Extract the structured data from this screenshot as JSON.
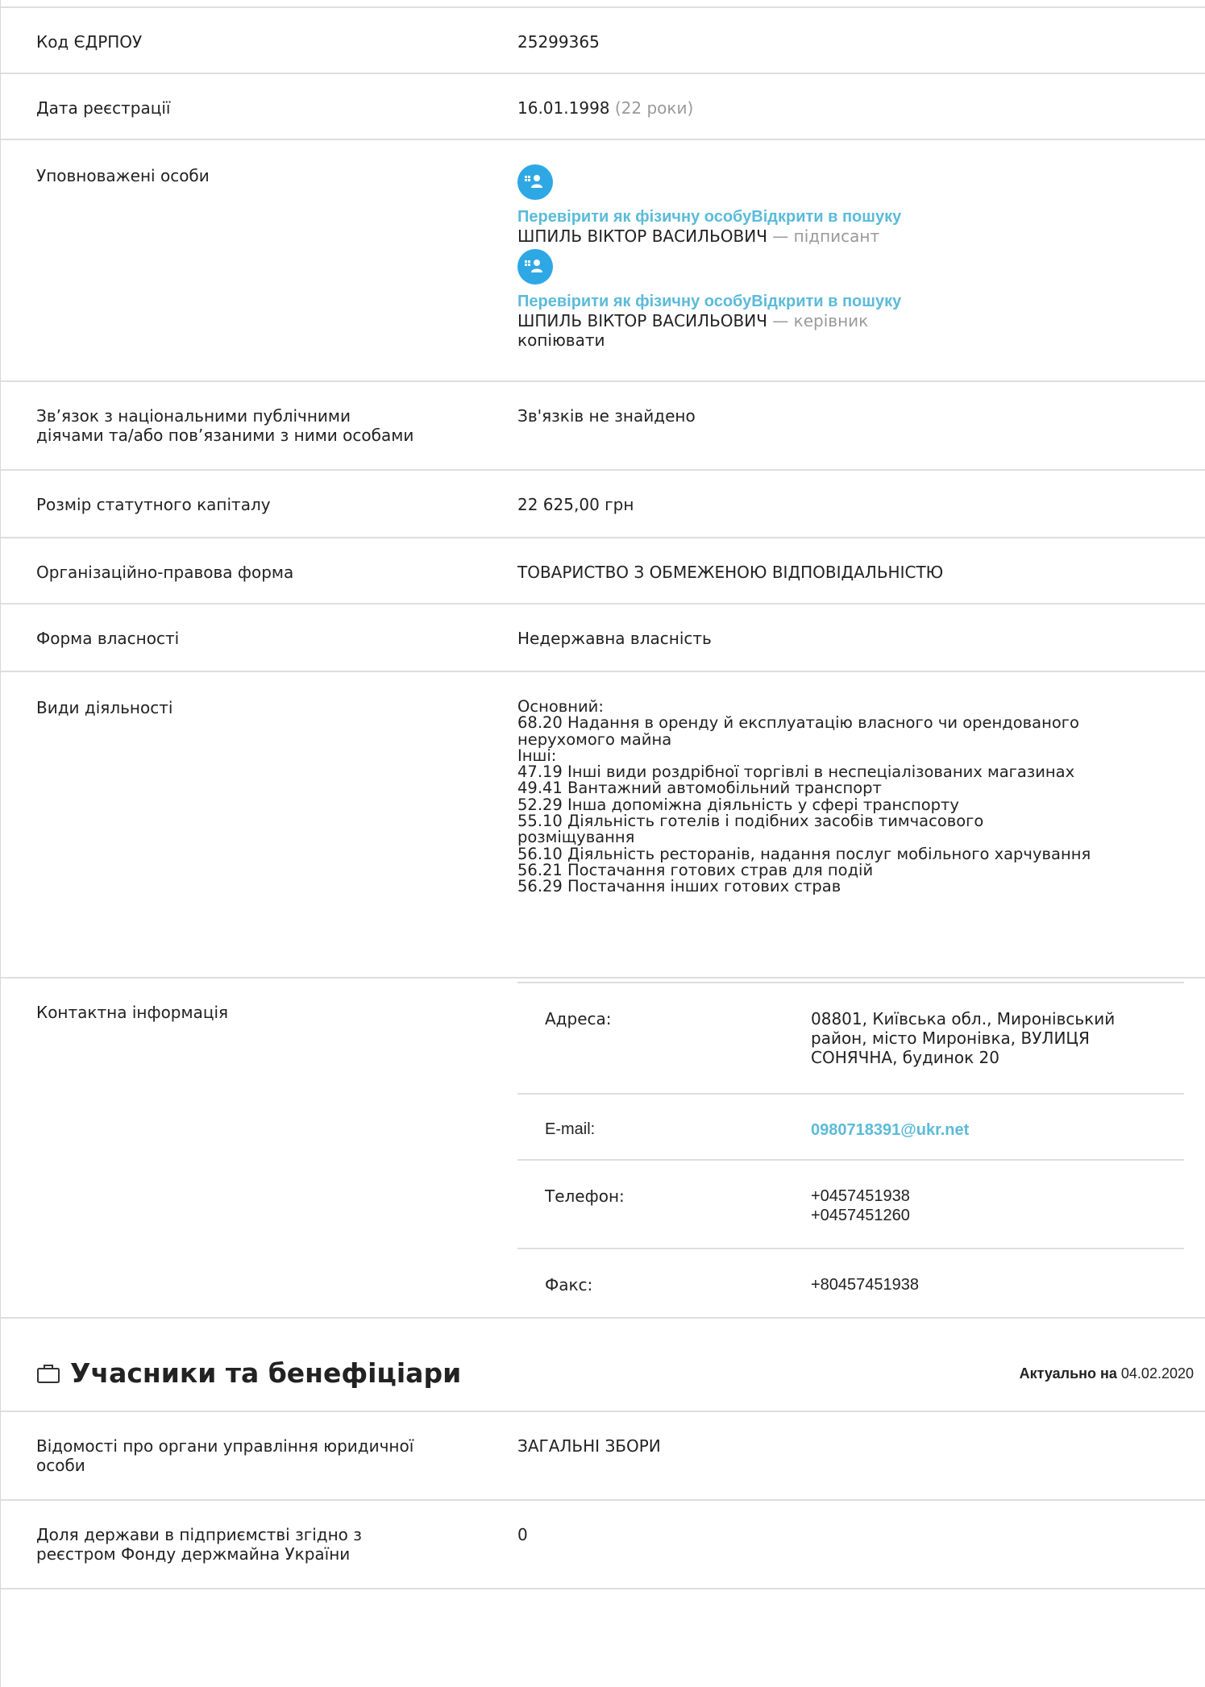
{
  "rows": {
    "edrpou": {
      "label": "Код ЄДРПОУ",
      "value": "25299365"
    },
    "reg_date": {
      "label": "Дата реєстрації",
      "value": "16.01.1998",
      "age": "(22 роки)"
    },
    "authorized": {
      "label": "Уповноважені особи",
      "persons": [
        {
          "check_link": "Перевірити як фізичну особу",
          "search_link": "Відкрити в пошуку",
          "name": "ШПИЛЬ ВІКТОР ВАСИЛЬОВИЧ",
          "role": "— підписант"
        },
        {
          "check_link": "Перевірити як фізичну особу",
          "search_link": "Відкрити в пошуку",
          "name": "ШПИЛЬ ВІКТОР ВАСИЛЬОВИЧ",
          "role": "— керівник"
        }
      ],
      "copy": "копіювати"
    },
    "pep": {
      "label_line1": "Зв’язок з національними публічними",
      "label_line2": "діячами та/або пов’язаними з ними особами",
      "value": "Зв'язків не знайдено"
    },
    "capital": {
      "label": "Розмір статутного капіталу",
      "value": "22 625,00 грн"
    },
    "legal_form": {
      "label": "Організаційно-правова форма",
      "value": "ТОВАРИСТВО З ОБМЕЖЕНОЮ ВІДПОВІДАЛЬНІСТЮ"
    },
    "ownership": {
      "label": "Форма власності",
      "value": "Недержавна власність"
    },
    "activities": {
      "label": "Види діяльності",
      "lines": [
        "Основний:",
        "68.20 Надання в оренду й експлуатацію власного чи орендованого",
        "нерухомого майна",
        "Інші:",
        "47.19 Інші види роздрібної торгівлі в неспеціалізованих магазинах",
        "49.41 Вантажний автомобільний транспорт",
        "52.29 Інша допоміжна діяльність у сфері транспорту",
        "55.10 Діяльність готелів і подібних засобів тимчасового",
        "розміщування",
        "56.10 Діяльність ресторанів, надання послуг мобільного харчування",
        "56.21 Постачання готових страв для подій",
        "56.29 Постачання інших готових страв"
      ]
    },
    "contacts": {
      "label": "Контактна інформація",
      "address_label": "Адреса:",
      "address_lines": [
        "08801, Київська обл., Миронівський",
        "район, місто Миронівка, ВУЛИЦЯ",
        "СОНЯЧНА, будинок 20"
      ],
      "email_label": "E-mail:",
      "email": "0980718391@ukr.net",
      "phone_label": "Телефон:",
      "phones": [
        "+0457451938",
        "+0457451260"
      ],
      "fax_label": "Факс:",
      "fax": "+80457451938"
    }
  },
  "section": {
    "title": "Учасники та бенефіціари",
    "actual_label": "Актуально на",
    "actual_date": "04.02.2020",
    "icon": "briefcase-icon"
  },
  "section_rows": {
    "governance": {
      "label_line1": "Відомості про органи управління юридичної",
      "label_line2": "особи",
      "value": "ЗАГАЛЬНІ ЗБОРИ"
    },
    "state_share": {
      "label_line1": "Доля держави в підприємстві згідно з",
      "label_line2": "реєстром Фонду держмайна України",
      "value": "0"
    }
  },
  "colors": {
    "link": "#5bbbd9",
    "icon_bg": "#2ea8e5",
    "muted": "#9a9a9a",
    "divider": "#dedede"
  }
}
